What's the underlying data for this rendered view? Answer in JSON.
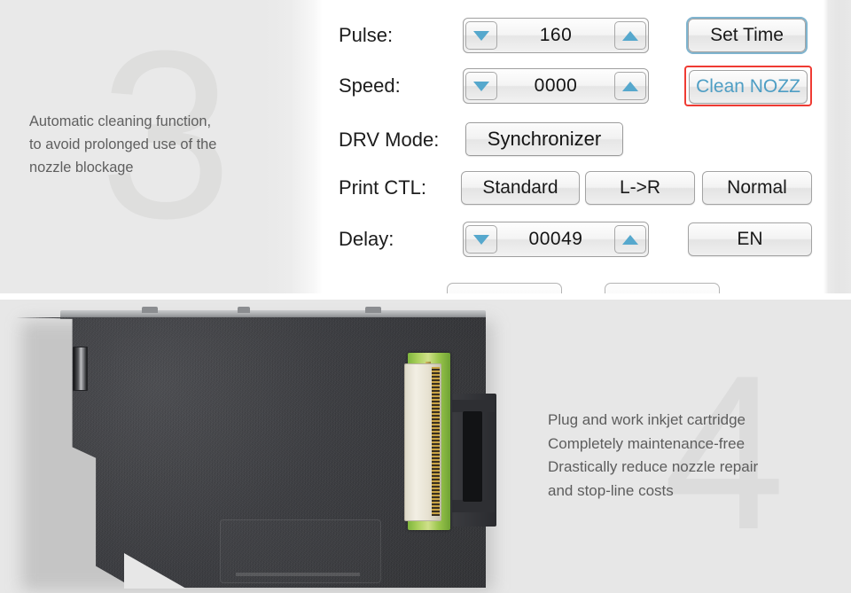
{
  "top_feature": {
    "watermark": "3",
    "text_lines": [
      "Automatic cleaning function,",
      "to avoid prolonged use of the",
      "nozzle blockage"
    ]
  },
  "control_panel": {
    "rows": [
      {
        "label": "Pulse:",
        "type": "spinner",
        "value": "160"
      },
      {
        "label": "Speed:",
        "type": "spinner",
        "value": "0000"
      },
      {
        "label": "DRV Mode:",
        "type": "field",
        "value": "Synchronizer"
      },
      {
        "label": "Print CTL:",
        "type": "buttons",
        "values": [
          "Standard",
          "L->R",
          "Normal"
        ]
      },
      {
        "label": "Delay:",
        "type": "spinner",
        "value": "00049"
      }
    ],
    "side_buttons": [
      {
        "label": "Set Time",
        "style": "blue-outline"
      },
      {
        "label": "Clean NOZZ",
        "style": "red-highlight"
      },
      {
        "label": "EN",
        "style": "plain"
      }
    ],
    "spinner_icons": {
      "decrement": "triangle-down-icon",
      "increment": "triangle-up-icon"
    },
    "colors": {
      "arrow_blue": "#56a8cd",
      "highlight_red": "#ef3b33",
      "outline_blue": "#7fb4cf",
      "clean_nozz_text": "#4e9ec4"
    }
  },
  "bottom_feature": {
    "watermark": "4",
    "text_lines": [
      "Plug and work inkjet cartridge",
      "Completely maintenance-free",
      "Drastically reduce nozzle repair",
      "and stop-line costs"
    ],
    "image_alt": "inkjet-cartridge-with-printhead"
  }
}
